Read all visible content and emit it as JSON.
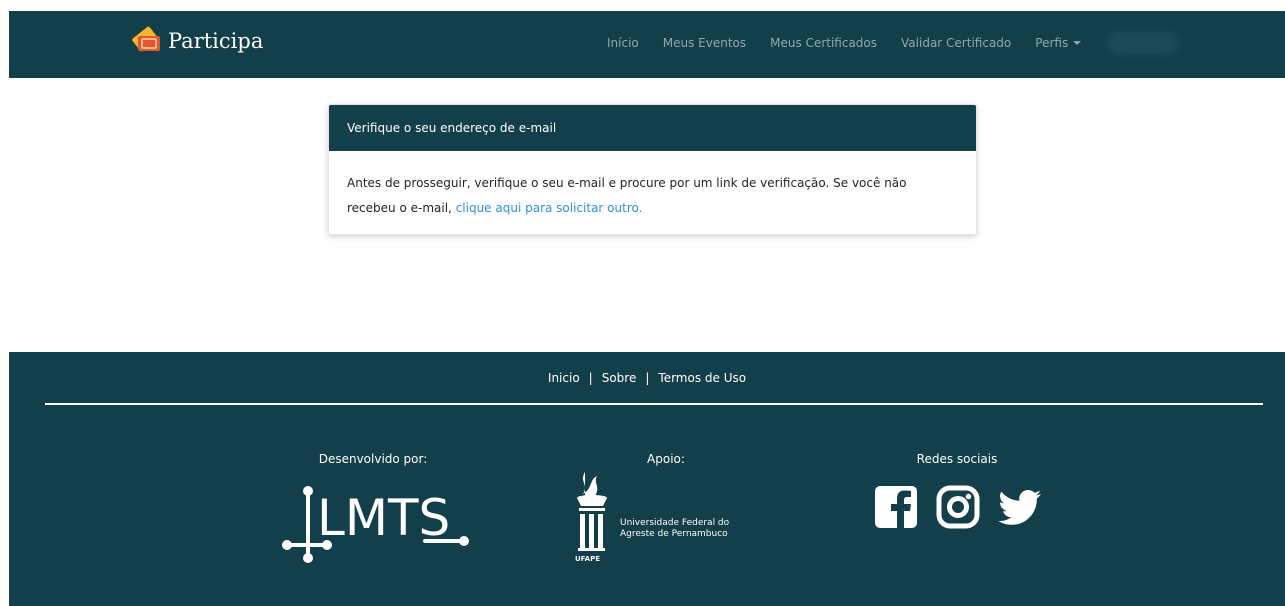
{
  "header": {
    "brand": "Participa",
    "nav": [
      {
        "label": "Início"
      },
      {
        "label": "Meus Eventos"
      },
      {
        "label": "Meus Certificados"
      },
      {
        "label": "Validar Certificado"
      },
      {
        "label": "Perfis"
      }
    ]
  },
  "card": {
    "title": "Verifique o seu endereço de e-mail",
    "text": "Antes de prosseguir, verifique o seu e-mail e procure por um link de verificação. Se você não recebeu o e-mail,",
    "link_text": "clique aqui para solicitar outro."
  },
  "footer": {
    "links": [
      "Inicio",
      "Sobre",
      "Termos de Uso"
    ],
    "separator": "|",
    "developed_by": "Desenvolvido por:",
    "developer_logo": "LMTS",
    "support": "Apoio:",
    "support_name_line1": "Universidade Federal do",
    "support_name_line2": "Agreste de Pernambuco",
    "support_abbrev": "UFAPE",
    "social_title": "Redes sociais",
    "social_icons": [
      "facebook-icon",
      "instagram-icon",
      "twitter-icon"
    ]
  },
  "colors": {
    "primary": "#123f4a",
    "link": "#3490dc",
    "nav_text": "#8fa9b0"
  }
}
